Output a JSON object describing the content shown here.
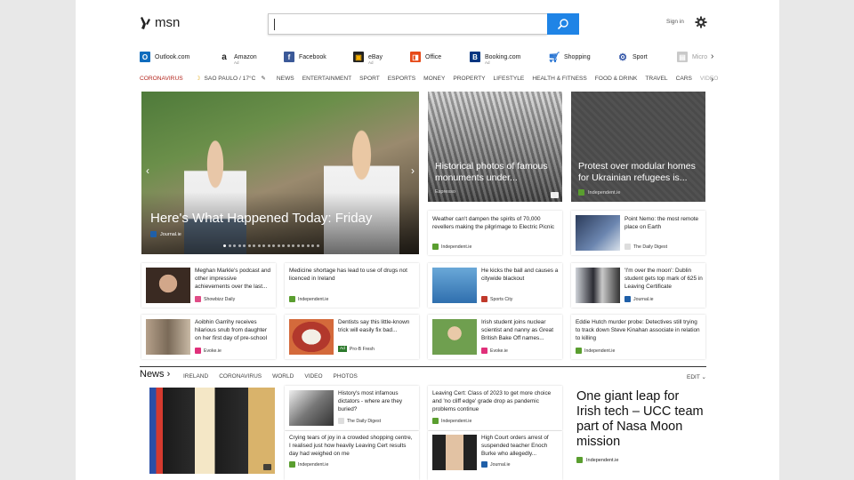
{
  "header": {
    "logo": "msn",
    "search_value": "",
    "sign_in": "Sign in"
  },
  "quick_links": [
    {
      "label": "Outlook.com",
      "icon": "outlook-icon",
      "color": "#0f6cbd",
      "ad": ""
    },
    {
      "label": "Amazon",
      "icon": "amazon-icon",
      "color": "#222222",
      "ad": "Ad"
    },
    {
      "label": "Facebook",
      "icon": "facebook-icon",
      "color": "#3b5998",
      "ad": ""
    },
    {
      "label": "eBay",
      "icon": "ebay-icon",
      "color": "#e53238",
      "ad": "Ad"
    },
    {
      "label": "Office",
      "icon": "office-icon",
      "color": "#e64a19",
      "ad": ""
    },
    {
      "label": "Booking.com",
      "icon": "booking-icon",
      "color": "#003580",
      "ad": "Ad"
    },
    {
      "label": "Shopping",
      "icon": "shopping-icon",
      "color": "#1f6fd1",
      "ad": ""
    },
    {
      "label": "Sport",
      "icon": "sport-icon",
      "color": "#3356a8",
      "ad": ""
    },
    {
      "label": "Micro",
      "icon": "micro-icon",
      "color": "#999999",
      "ad": ""
    }
  ],
  "nav": {
    "coronavirus": "CORONAVIRUS",
    "weather": "SAO PAULO / 17°C",
    "items": [
      "NEWS",
      "ENTERTAINMENT",
      "SPORT",
      "ESPORTS",
      "MONEY",
      "PROPERTY",
      "LIFESTYLE",
      "HEALTH & FITNESS",
      "FOOD & DRINK",
      "TRAVEL",
      "CARS",
      "VIDEO"
    ]
  },
  "hero": {
    "title": "Here's What Happened Today: Friday",
    "source": "Journal.ie"
  },
  "tiles": [
    {
      "title": "Historical photos of famous monuments under...",
      "source": "Espresso"
    },
    {
      "title": "Protest over modular homes for Ukrainian refugees is...",
      "source": "Independent.ie"
    }
  ],
  "stories": [
    {
      "text": "Weather can't dampen the spirits of 70,000 revellers making the pilgrimage to Electric Picnic",
      "source": "Independent.ie"
    },
    {
      "text": "Point Nemo: the most remote place on Earth",
      "source": "The Daily Digest"
    },
    {
      "text": "Meghan Markle's podcast and other impressive achievements over the last...",
      "source": "Showbizz Daily"
    },
    {
      "text": "Medicine shortage has lead to use of drugs not licenced in Ireland",
      "source": "Independent.ie"
    },
    {
      "text": "He kicks the ball and causes a citywide blackout",
      "source": "Sports City"
    },
    {
      "text": "'I'm over the moon': Dublin student gets top mark of 625 in Leaving Certificate",
      "source": "Journal.ie"
    },
    {
      "text": "Aoibhin Garrihy receives hilarious snub from daughter on her first day of pre-school",
      "source": "Evoke.ie"
    },
    {
      "text": "Dentists say this little-known trick will easily fix bad...",
      "source": "Pro-B Fresh",
      "ad": "Ad"
    },
    {
      "text": "Irish student joins nuclear scientist and nanny as Great British Bake Off names...",
      "source": "Evoke.ie"
    },
    {
      "text": "Eddie Hutch murder probe: Detectives still trying to track down Steve Kinahan associate in relation to killing",
      "source": "Independent.ie"
    }
  ],
  "news": {
    "heading": "News",
    "tabs": [
      "IRELAND",
      "CORONAVIRUS",
      "WORLD",
      "VIDEO",
      "PHOTOS"
    ],
    "edit": "EDIT",
    "items": [
      {
        "text": "History's most infamous dictators - where are they buried?",
        "source": "The Daily Digest"
      },
      {
        "text": "Leaving Cert: Class of 2023 to get more choice and 'no cliff edge' grade drop as pandemic problems continue",
        "source": "Independent.ie"
      },
      {
        "text": "Crying tears of joy in a crowded shopping centre, I realised just how heavily Leaving Cert results day had weighed on me",
        "source": "Independent.ie"
      },
      {
        "text": "High Court orders arrest of suspended teacher Enoch Burke who allegedly...",
        "source": "Journal.ie"
      }
    ],
    "feature": {
      "title": "One giant leap for Irish tech – UCC team part of Nasa Moon mission",
      "source": "Independent.ie"
    }
  }
}
